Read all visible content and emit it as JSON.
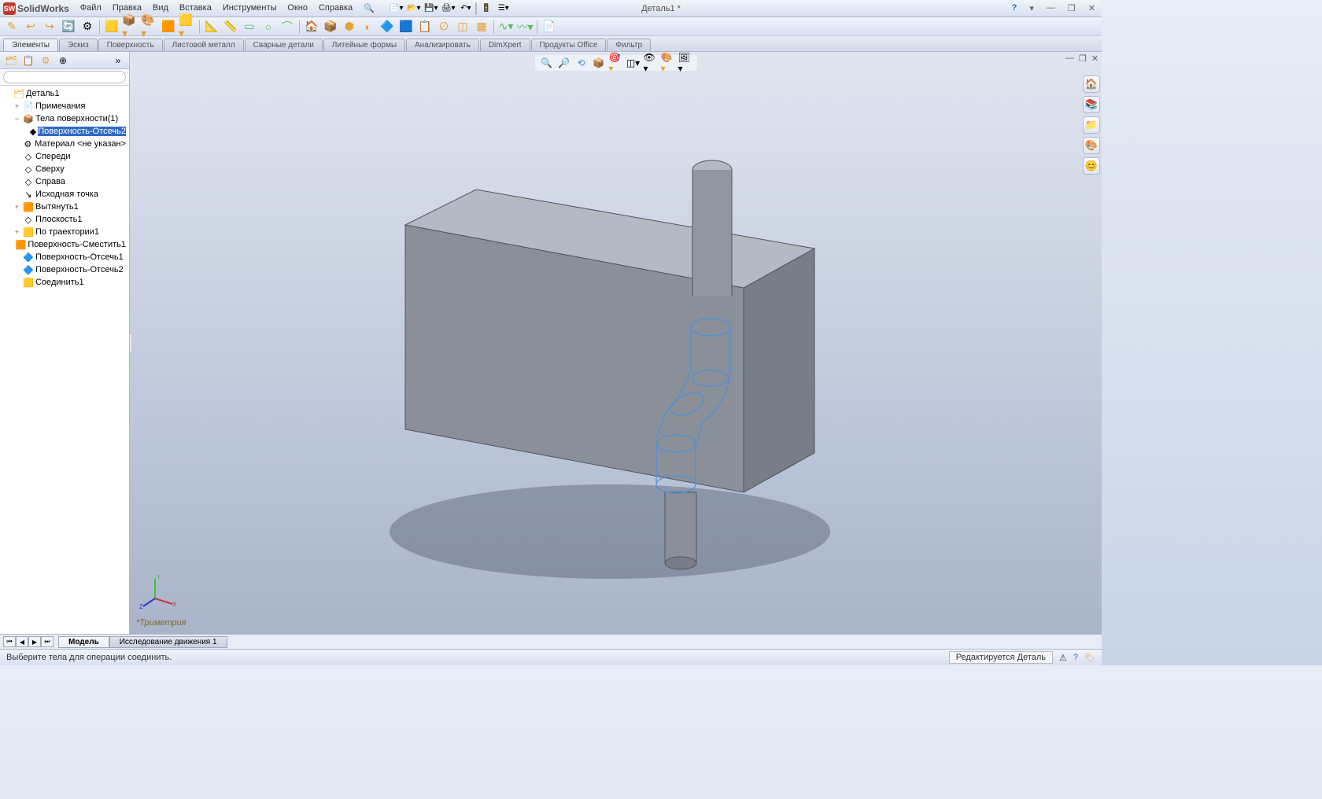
{
  "app": {
    "name": "SolidWorks",
    "doc_title": "Деталь1 *"
  },
  "menu": [
    "Файл",
    "Правка",
    "Вид",
    "Вставка",
    "Инструменты",
    "Окно",
    "Справка"
  ],
  "command_tabs": [
    "Элементы",
    "Эскиз",
    "Поверхность",
    "Листовой металл",
    "Сварные детали",
    "Литейные формы",
    "Анализировать",
    "DimXpert",
    "Продукты Office",
    "Фильтр"
  ],
  "tree": {
    "root": "Деталь1",
    "items": [
      {
        "label": "Примечания",
        "indent": 1,
        "exp": "+",
        "icon": "📄"
      },
      {
        "label": "Тела поверхности(1)",
        "indent": 1,
        "exp": "−",
        "icon": "📦"
      },
      {
        "label": "Поверхность-Отсечь2",
        "indent": 2,
        "exp": "",
        "icon": "◆",
        "selected": true
      },
      {
        "label": "Материал <не указан>",
        "indent": 1,
        "exp": "",
        "icon": "⚙"
      },
      {
        "label": "Спереди",
        "indent": 1,
        "exp": "",
        "icon": "◇"
      },
      {
        "label": "Сверху",
        "indent": 1,
        "exp": "",
        "icon": "◇"
      },
      {
        "label": "Справа",
        "indent": 1,
        "exp": "",
        "icon": "◇"
      },
      {
        "label": "Исходная точка",
        "indent": 1,
        "exp": "",
        "icon": "↘"
      },
      {
        "label": "Вытянуть1",
        "indent": 1,
        "exp": "+",
        "icon": "🟧"
      },
      {
        "label": "Плоскость1",
        "indent": 1,
        "exp": "",
        "icon": "◇"
      },
      {
        "label": "По траектории1",
        "indent": 1,
        "exp": "+",
        "icon": "🟨"
      },
      {
        "label": "Поверхность-Сместить1",
        "indent": 1,
        "exp": "",
        "icon": "🟧"
      },
      {
        "label": "Поверхность-Отсечь1",
        "indent": 1,
        "exp": "",
        "icon": "🔷"
      },
      {
        "label": "Поверхность-Отсечь2",
        "indent": 1,
        "exp": "",
        "icon": "🔷"
      },
      {
        "label": "Соединить1",
        "indent": 1,
        "exp": "",
        "icon": "🟨"
      }
    ]
  },
  "view_label": "*Триметрия",
  "bottom_tabs": [
    "Модель",
    "Исследование движения 1"
  ],
  "status": {
    "left": "Выберите тела для операции соединить.",
    "right": "Редактируется Деталь"
  },
  "help_icon": "?"
}
